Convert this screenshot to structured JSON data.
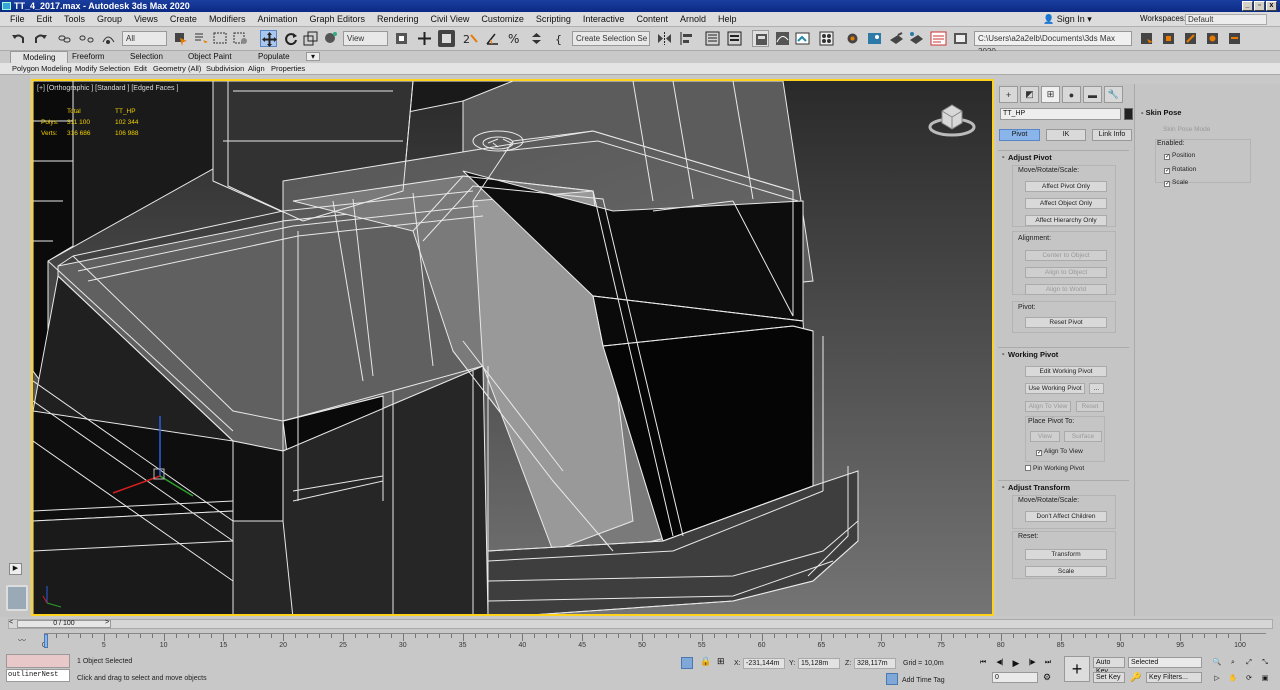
{
  "window": {
    "title": "TT_4_2017.max - Autodesk 3ds Max 2020"
  },
  "menu": {
    "items": [
      "File",
      "Edit",
      "Tools",
      "Group",
      "Views",
      "Create",
      "Modifiers",
      "Animation",
      "Graph Editors",
      "Rendering",
      "Civil View",
      "Customize",
      "Scripting",
      "Interactive",
      "Content",
      "Arnold",
      "Help"
    ],
    "sign_in": "Sign In",
    "workspaces_label": "Workspaces:",
    "workspaces_value": "Default"
  },
  "toolbar": {
    "filter": "All",
    "ref_coord": "View",
    "selection_set": "Create Selection Se",
    "project_path": "C:\\Users\\a2a2elb\\Documents\\3ds Max 2020"
  },
  "ribbon": {
    "tabs": [
      "Modeling",
      "Freeform",
      "Selection",
      "Object Paint",
      "Populate"
    ],
    "subtabs": [
      "Polygon Modeling",
      "Modify Selection",
      "Edit",
      "Geometry (All)",
      "Subdivision",
      "Align",
      "Properties"
    ]
  },
  "viewport": {
    "label": "[+] [Orthographic ] [Standard ] [Edged Faces ]",
    "stats": {
      "headers": [
        "Total",
        "TT_HP"
      ],
      "rows": [
        {
          "label": "Polys:",
          "total": "311 100",
          "sel": "102 344"
        },
        {
          "label": "Verts:",
          "total": "316 686",
          "sel": "106 988"
        }
      ]
    }
  },
  "command_panel": {
    "object_name": "TT_HP",
    "hier_tabs": [
      "Pivot",
      "IK",
      "Link Info"
    ],
    "adjust_pivot": {
      "title": "Adjust Pivot",
      "move_label": "Move/Rotate/Scale:",
      "btn1": "Affect Pivot Only",
      "btn2": "Affect Object Only",
      "btn3": "Affect Hierarchy Only",
      "align_label": "Alignment:",
      "align1": "Center to Object",
      "align2": "Align to Object",
      "align3": "Align to World",
      "pivot_label": "Pivot:",
      "reset": "Reset Pivot"
    },
    "working_pivot": {
      "title": "Working Pivot",
      "edit": "Edit Working Pivot",
      "use": "Use Working Pivot",
      "more": "...",
      "align_view": "Align To View",
      "reset": "Reset",
      "place_label": "Place Pivot To:",
      "view": "View",
      "surface": "Surface",
      "align_to_view_chk": "Align To View",
      "pin": "Pin Working Pivot"
    },
    "adjust_transform": {
      "title": "Adjust Transform",
      "move_label": "Move/Rotate/Scale:",
      "dont_affect": "Don't Affect Children",
      "reset_label": "Reset:",
      "transform": "Transform",
      "scale": "Scale"
    }
  },
  "skin_pose": {
    "title": "Skin Pose",
    "mode": "Skin Pose Mode",
    "enabled_label": "Enabled:",
    "position": "Position",
    "rotation": "Rotation",
    "scale": "Scale"
  },
  "timeline": {
    "frame": "0 / 100",
    "ticks": [
      "0",
      "5",
      "10",
      "15",
      "20",
      "25",
      "30",
      "35",
      "40",
      "45",
      "50",
      "55",
      "60",
      "65",
      "70",
      "75",
      "80",
      "85",
      "90",
      "95",
      "100"
    ]
  },
  "status": {
    "script_field": "outlinerNest",
    "selected": "1 Object Selected",
    "prompt": "Click and drag to select and move objects",
    "x_label": "X:",
    "x": "-231,144m",
    "y_label": "Y:",
    "y": "15,128m",
    "z_label": "Z:",
    "z": "328,117m",
    "grid": "Grid = 10,0m",
    "add_time_tag": "Add Time Tag",
    "auto_key": "Auto Key",
    "set_key": "Set Key",
    "selected_dd": "Selected",
    "key_filters": "Key Filters...",
    "frame_field": "0"
  }
}
